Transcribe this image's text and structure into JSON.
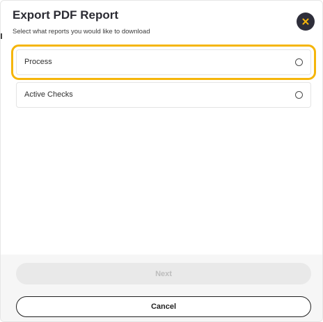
{
  "dialog": {
    "title": "Export PDF Report",
    "subtitle": "Select what reports you would like to download",
    "close_icon": "close-icon"
  },
  "options": [
    {
      "label": "Process",
      "selected": false,
      "highlighted": true
    },
    {
      "label": "Active Checks",
      "selected": false,
      "highlighted": false
    }
  ],
  "footer": {
    "next_label": "Next",
    "next_disabled": true,
    "cancel_label": "Cancel"
  },
  "colors": {
    "highlight": "#f5b50a",
    "close_button_bg": "#2e2e3a",
    "close_icon": "#f5b50a"
  }
}
